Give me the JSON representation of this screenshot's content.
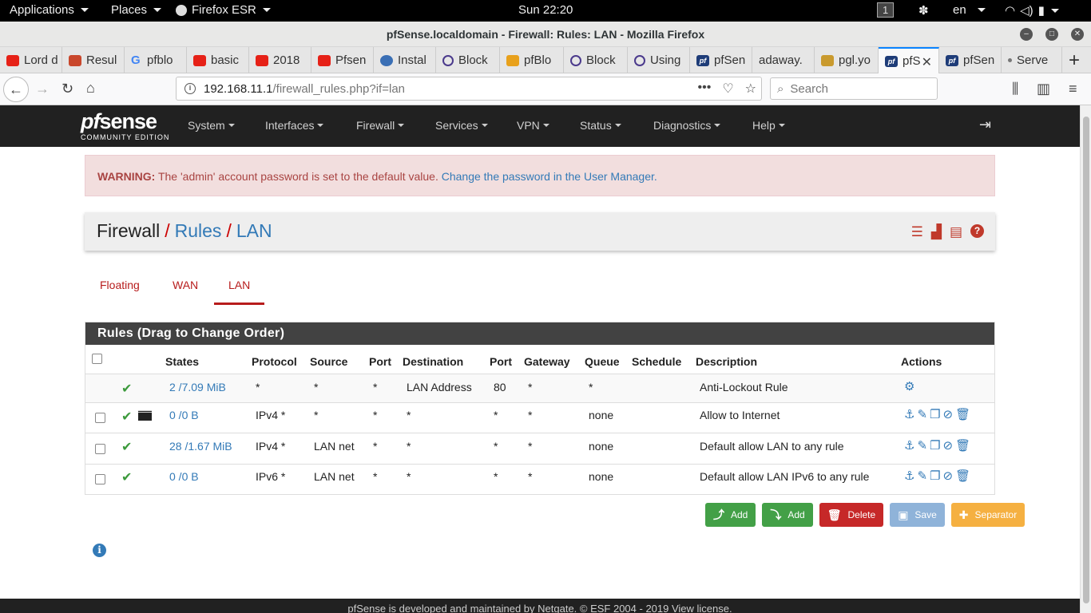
{
  "gnome": {
    "applications": "Applications",
    "places": "Places",
    "app_name": "Firefox ESR",
    "clock": "Sun 22:20",
    "workspace": "1",
    "lang": "en"
  },
  "window": {
    "title": "pfSense.localdomain - Firewall: Rules: LAN - Mozilla Firefox"
  },
  "tabs": [
    {
      "label": "Lord d",
      "icon": "youtube-icon"
    },
    {
      "label": "Resul",
      "icon": "cube-icon"
    },
    {
      "label": "pfblo",
      "icon": "google-icon"
    },
    {
      "label": "basic",
      "icon": "youtube-icon"
    },
    {
      "label": "2018",
      "icon": "youtube-icon"
    },
    {
      "label": "Pfsen",
      "icon": "youtube-icon"
    },
    {
      "label": "Instal",
      "icon": "globe-icon"
    },
    {
      "label": "Block",
      "icon": "ring-icon"
    },
    {
      "label": "pfBlo",
      "icon": "orange-icon"
    },
    {
      "label": "Block",
      "icon": "ring-icon"
    },
    {
      "label": "Using",
      "icon": "ring-icon"
    },
    {
      "label": "pfSen",
      "icon": "pfsense-icon"
    },
    {
      "label": "adaway.",
      "icon": ""
    },
    {
      "label": "pgl.yo",
      "icon": "doc-icon"
    },
    {
      "label": "pfS",
      "icon": "pfsense-icon"
    },
    {
      "label": "pfSen",
      "icon": "pfsense-icon"
    },
    {
      "label": "Serve",
      "icon": "dot-icon"
    }
  ],
  "navbar": {
    "url_host": "192.168.11.1",
    "url_path": "/firewall_rules.php?if=lan",
    "search_placeholder": "Search"
  },
  "pfsense": {
    "logo_main": "sense",
    "logo_pf": "pf",
    "logo_sub": "COMMUNITY EDITION",
    "menu": [
      "System",
      "Interfaces",
      "Firewall",
      "Services",
      "VPN",
      "Status",
      "Diagnostics",
      "Help"
    ]
  },
  "warning": {
    "label": "WARNING:",
    "text": " The 'admin' account password is set to the default value. ",
    "link": "Change the password in the User Manager."
  },
  "breadcrumb": {
    "part1": "Firewall",
    "sep": "/",
    "part2": "Rules",
    "part3": "LAN"
  },
  "subtabs": [
    "Floating",
    "WAN",
    "LAN"
  ],
  "panel": {
    "title": "Rules (Drag to Change Order)",
    "columns": [
      "States",
      "Protocol",
      "Source",
      "Port",
      "Destination",
      "Port",
      "Gateway",
      "Queue",
      "Schedule",
      "Description",
      "Actions"
    ],
    "rows": [
      {
        "states": "2 /7.09 MiB",
        "protocol": "*",
        "source": "*",
        "port": "*",
        "destination": "LAN Address",
        "dport": "80",
        "gateway": "*",
        "queue": "*",
        "schedule": "",
        "description": "Anti-Lockout Rule"
      },
      {
        "states": "0 /0 B",
        "protocol": "IPv4 *",
        "source": "*",
        "port": "*",
        "destination": "*",
        "dport": "*",
        "gateway": "*",
        "queue": "none",
        "schedule": "",
        "description": "Allow to Internet"
      },
      {
        "states": "28 /1.67 MiB",
        "protocol": "IPv4 *",
        "source": "LAN net",
        "port": "*",
        "destination": "*",
        "dport": "*",
        "gateway": "*",
        "queue": "none",
        "schedule": "",
        "description": "Default allow LAN to any rule"
      },
      {
        "states": "0 /0 B",
        "protocol": "IPv6 *",
        "source": "LAN net",
        "port": "*",
        "destination": "*",
        "dport": "*",
        "gateway": "*",
        "queue": "none",
        "schedule": "",
        "description": "Default allow LAN IPv6 to any rule"
      }
    ]
  },
  "buttons": {
    "add_top": "Add",
    "add_bottom": "Add",
    "delete": "Delete",
    "save": "Save",
    "separator": "Separator"
  },
  "footer": {
    "text": "pfSense is developed and maintained by Netgate. © ESF 2004 - 2019 View license."
  },
  "colors": {
    "accent": "#337ab7",
    "pf_red": "#b71c1c",
    "header_bg": "#212121",
    "success": "#43a047"
  }
}
